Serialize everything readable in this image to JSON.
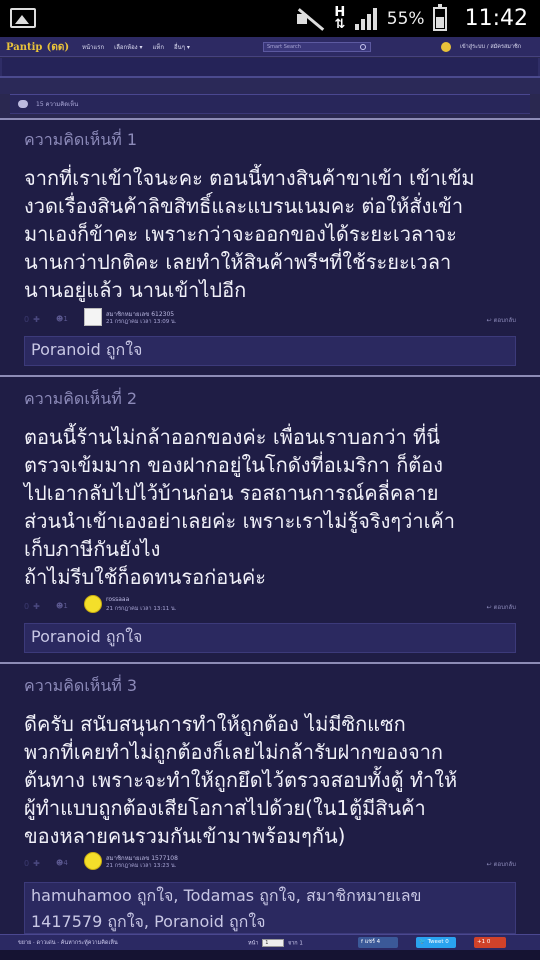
{
  "status_bar": {
    "network": "H",
    "battery": "55%",
    "time": "11:42"
  },
  "header": {
    "logo": "Pantip",
    "nav": [
      "หน้าแรก",
      "เลือกห้อง ▾",
      "แท็ก",
      "อื่นๆ ▾"
    ],
    "search_placeholder": "Smart Search",
    "login": "เข้าสู่ระบบ / สมัครสมาชิก"
  },
  "comment_count": "15 ความคิดเห็น",
  "comments": [
    {
      "title": "ความคิดเห็นที่ 1",
      "text": "จากที่เราเข้าใจนะคะ ตอนนี้ทางสินค้าขาเข้า เข้าเข้ม\nงวดเรื่องสินค้าลิขสิทธิ์และแบรนเนมคะ ต่อให้สั่งเข้า\nมาเองก็ข้าคะ เพราะกว่าจะออกของได้ระยะเวลาจะ\nนานกว่าปกติคะ เลยทำให้สินค้าพรีฯที่ใช้ระยะเวลา\nนานอยู่แล้ว นานเข้าไปอีก",
      "votes": "0",
      "emotion": "1",
      "user": "สมาชิกหมายเลข 612305",
      "date": "21 กรกฎาคม เวลา 13:09 น.",
      "reply": "ตอบกลับ",
      "likes": "Poranoid ถูกใจ"
    },
    {
      "title": "ความคิดเห็นที่ 2",
      "text": "ตอนนี้ร้านไม่กล้าออกของค่ะ เพื่อนเราบอกว่า ที่นี่\nตรวจเข้มมาก ของฝากอยู่ในโกดังที่อเมริกา ก็ต้อง\nไปเอากลับไปไว้บ้านก่อน รอสถานการณ์คลี่คลาย\nส่วนนำเข้าเองอย่าเลยค่ะ เพราะเราไม่รู้จริงๆว่าเค้า\nเก็บภาษีกันยังไง\nถ้าไม่รีบใช้ก็อดทนรอก่อนค่ะ",
      "votes": "0",
      "emotion": "1",
      "user": "rossaaa",
      "date": "21 กรกฎาคม เวลา 13:11 น.",
      "reply": "ตอบกลับ",
      "likes": "Poranoid ถูกใจ"
    },
    {
      "title": "ความคิดเห็นที่ 3",
      "text": "ดีครับ สนับสนุนการทำให้ถูกต้อง ไม่มีซิกแซก\nพวกที่เคยทำไม่ถูกต้องก็เลยไม่กล้ารับฝากของจาก\nต้นทาง เพราะจะทำให้ถูกยึดไว้ตรวจสอบทั้งตู้ ทำให้\nผู้ทำแบบถูกต้องเสียโอกาสไปด้วย(ใน1ตู้มีสินค้า\nของหลายคนรวมกันเข้ามาพร้อมๆกัน)",
      "votes": "0",
      "emotion": "4",
      "user": "สมาชิกหมายเลข 1577108",
      "date": "21 กรกฎาคม เวลา 13:23 น.",
      "reply": "ตอบกลับ",
      "likes": "hamuhamoo ถูกใจ, Todamas ถูกใจ, สมาชิกหมายเลข\n1417579 ถูกใจ, Poranoid ถูกใจ"
    }
  ],
  "bottom_bar": {
    "left": "ขยาย  ·  ดาวเด่น  ·  ค้นหากระทู้ความคิดเห็น",
    "page_label": "หน้า",
    "page_value": "1",
    "page_total": "จาก 1",
    "share_fb": "แชร์",
    "share_fb_count": "4",
    "share_tw": "Tweet",
    "share_tw_count": "0",
    "share_g": "+1",
    "share_g_count": "0"
  },
  "colors": {
    "background": "#1f1d45",
    "header": "#2d2a63",
    "text": "#f0f0f8",
    "muted": "#8c8ab9"
  }
}
